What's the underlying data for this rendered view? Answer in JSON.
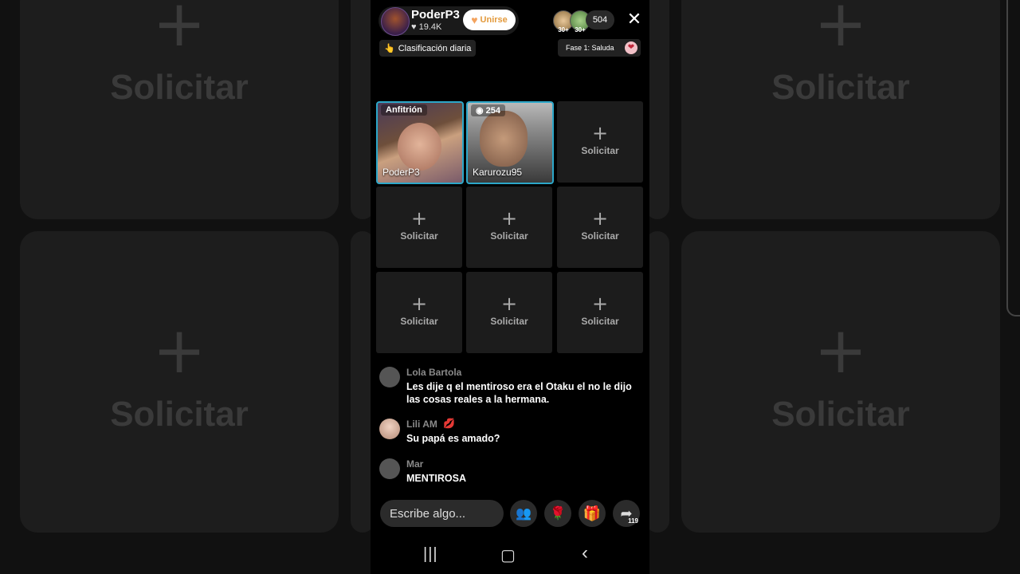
{
  "background": {
    "ghost_tiles": [
      {
        "plus": "+",
        "label": "Solicitar"
      },
      {
        "plus": "+",
        "label": "Solicitar"
      },
      {
        "plus": "+",
        "label": "Solicitar"
      },
      {
        "plus": "+",
        "label": "Solicitar"
      }
    ]
  },
  "header": {
    "host_name": "PoderP3",
    "likes": "♥ 19.4K",
    "join_label": "Unirse",
    "viewers": [
      {
        "badge": "30+"
      },
      {
        "badge": "30+"
      }
    ],
    "viewer_count": "504",
    "close_glyph": "✕"
  },
  "badges": {
    "ranking": "Clasificación diaria",
    "ranking_icon": "👆",
    "phase": "Fase 1: Saluda"
  },
  "grid": {
    "host_tile": {
      "tag": "Anfitrión",
      "name": "PoderP3"
    },
    "guest_tile": {
      "tag": "◉ 254",
      "name": "Karurozu95"
    },
    "empty_plus": "+",
    "empty_label": "Solicitar"
  },
  "chat": {
    "messages": [
      {
        "user": "Lola Bartola",
        "text": "Les dije q el mentiroso era el Otaku el no le dijo las cosas reales a la hermana."
      },
      {
        "user": "Lili AM",
        "text": "Su papá es amado?"
      },
      {
        "user": "Mar",
        "text": "MENTIROSA"
      }
    ]
  },
  "bottom": {
    "input_placeholder": "Escribe algo...",
    "share_count": "119"
  },
  "navbar": {
    "recents": "|||",
    "home": "▢",
    "back": "‹"
  },
  "colors": {
    "accent_blue": "#2ca7c9",
    "join_orange": "#e39a3c",
    "action_pink": "#e2336b"
  }
}
